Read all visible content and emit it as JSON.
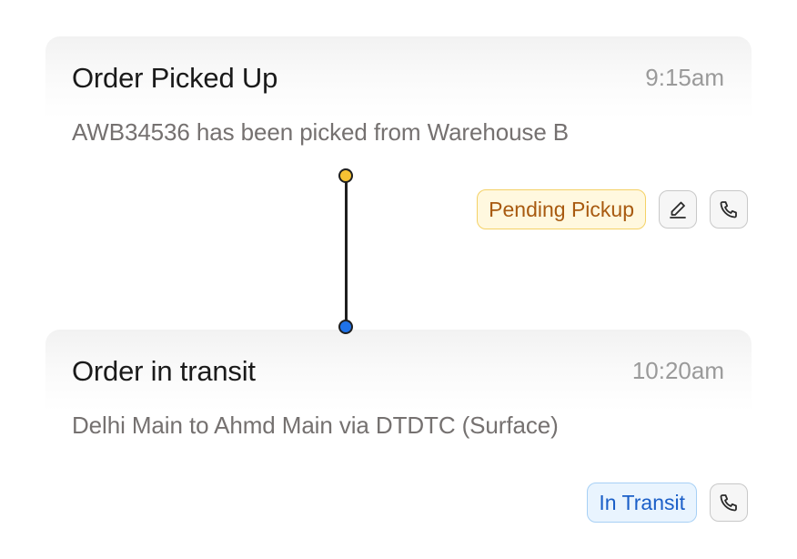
{
  "events": [
    {
      "title": "Order Picked Up",
      "time": "9:15am",
      "description": "AWB34536 has been picked from Warehouse B",
      "status": "Pending Pickup",
      "status_color": "#a85a10",
      "dot_color": "#f7c233",
      "actions": [
        "edit-icon",
        "phone-icon"
      ]
    },
    {
      "title": "Order in transit",
      "time": "10:20am",
      "description": "Delhi Main to Ahmd Main via DTDTC (Surface)",
      "status": "In Transit",
      "status_color": "#1b5fc8",
      "dot_color": "#1f72e8",
      "actions": [
        "phone-icon"
      ]
    }
  ]
}
